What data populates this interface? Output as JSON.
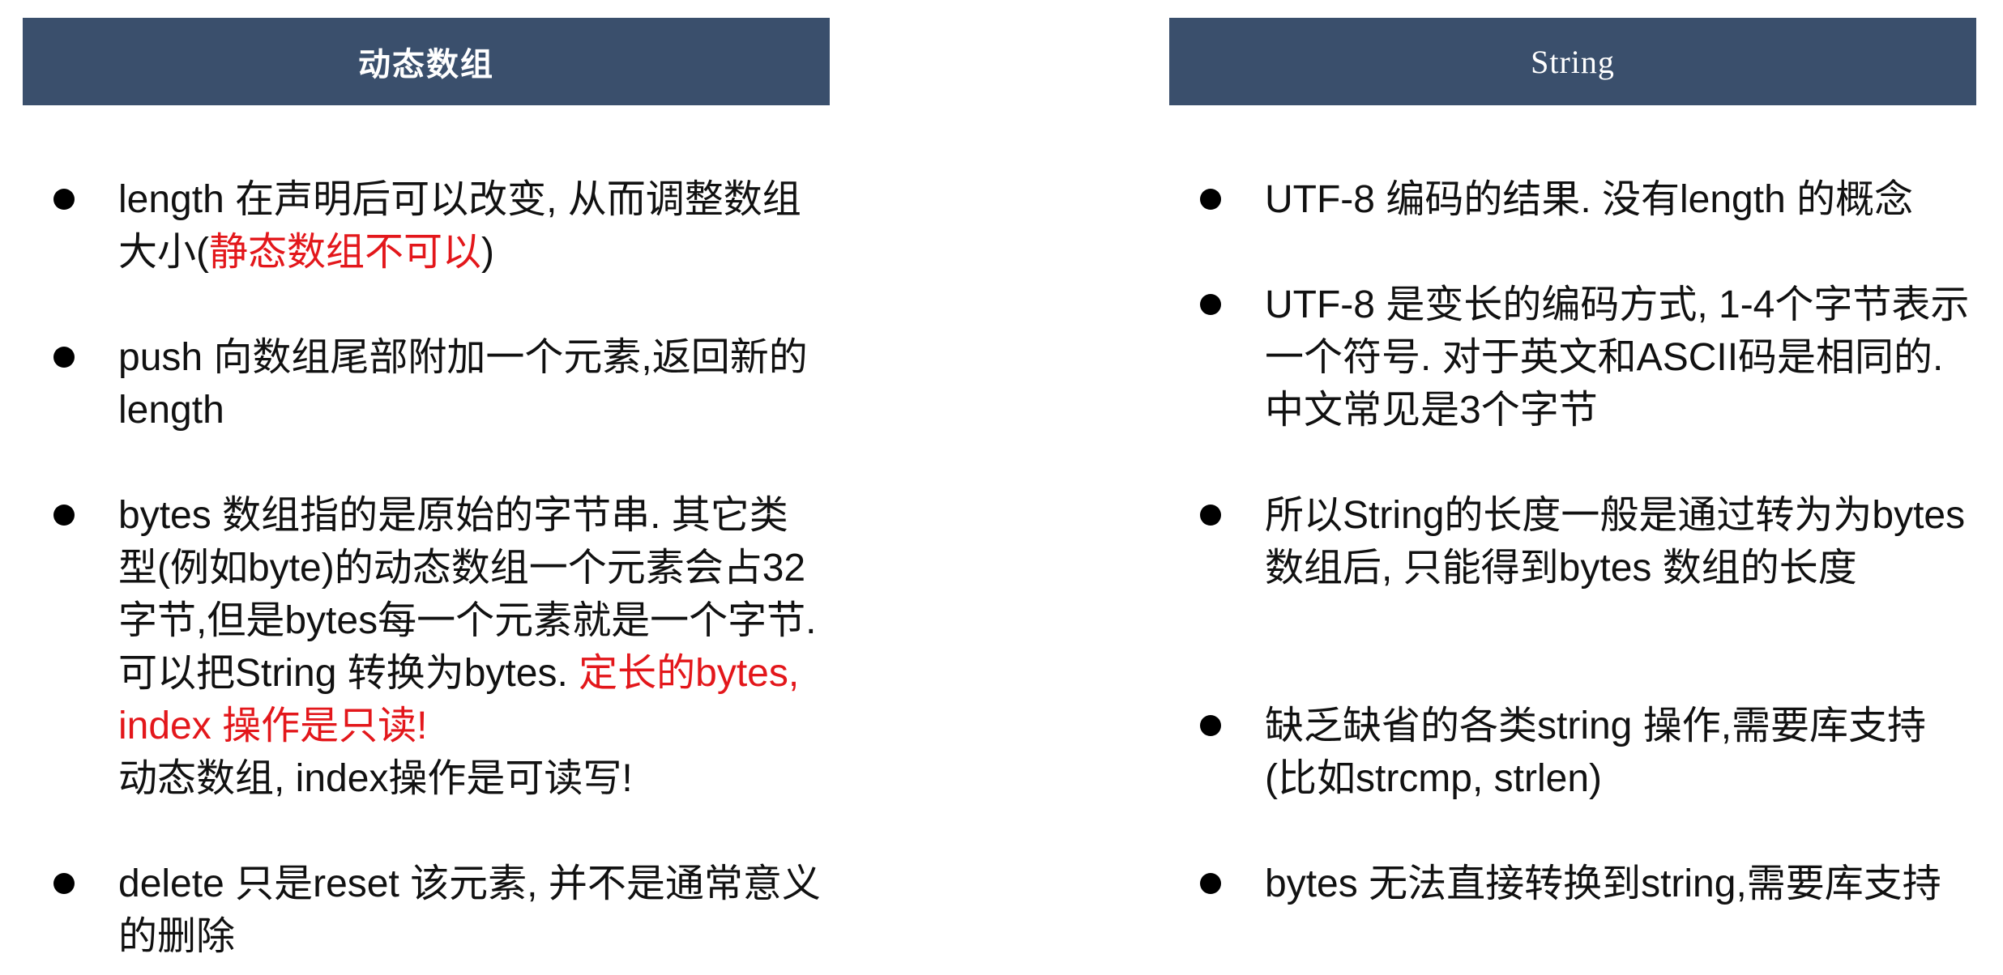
{
  "left": {
    "title": "动态数组",
    "items": [
      {
        "t1": "length 在声明后可以改变, 从而调整数组大小(",
        "t2": "静态数组不可以",
        "t3": ")"
      },
      {
        "t1": "push 向数组尾部附加一个元素,返回新的length"
      },
      {
        "t1": "bytes 数组指的是原始的字节串. 其它类型(例如byte)的动态数组一个元素会占32字节,但是bytes每一个元素就是一个字节. 可以把String 转换为bytes. ",
        "t2": "定长的bytes, index 操作是只读!",
        "t3": "动态数组, index操作是可读写!"
      },
      {
        "t1": "delete 只是reset 该元素, 并不是通常意义的删除"
      }
    ]
  },
  "right": {
    "title": "String",
    "items": [
      {
        "t1": "UTF-8 编码的结果. 没有length 的概念"
      },
      {
        "t1": "UTF-8 是变长的编码方式, 1-4个字节表示一个符号. 对于英文和ASCII码是相同的.中文常见是3个字节"
      },
      {
        "t1": "所以String的长度一般是通过转为为bytes数组后, 只能得到bytes 数组的长度"
      },
      {
        "t1": "缺乏缺省的各类string 操作,需要库支持(比如strcmp, strlen)"
      },
      {
        "t1": "bytes 无法直接转换到string,需要库支持"
      }
    ]
  },
  "colors": {
    "header_bg": "#3a4f6c",
    "highlight": "#e3171b"
  }
}
